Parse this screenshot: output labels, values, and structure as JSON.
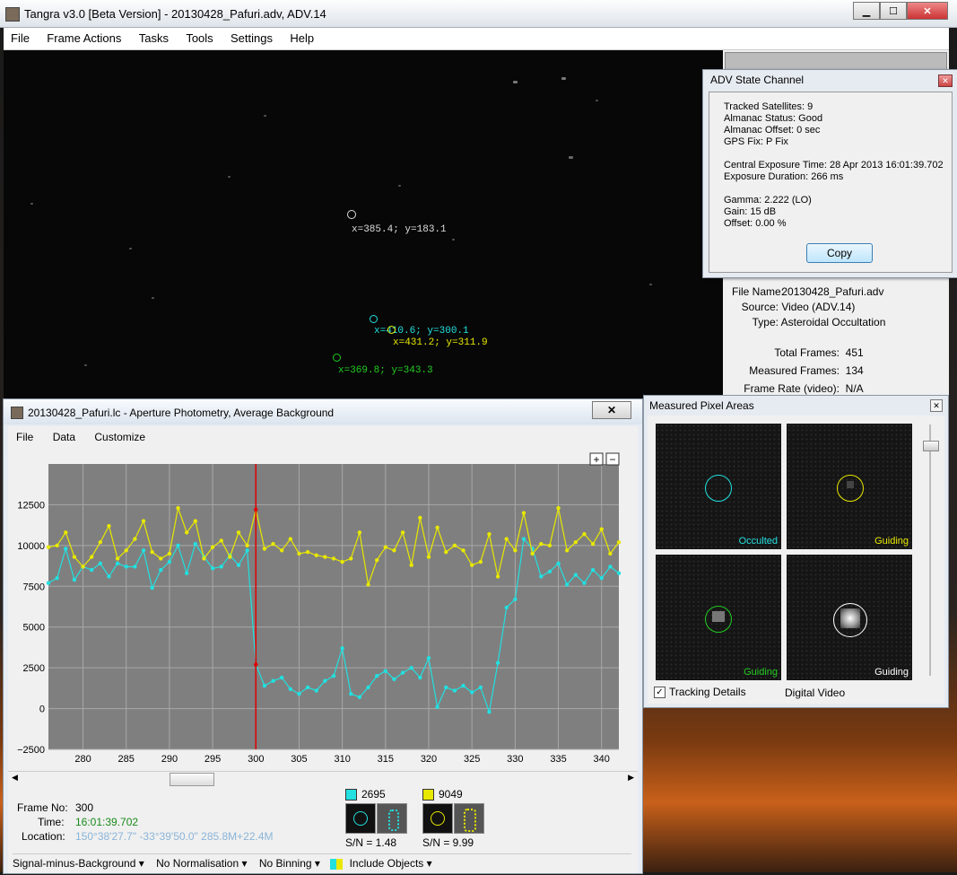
{
  "main": {
    "title": "Tangra v3.0 [Beta Version] - 20130428_Pafuri.adv, ADV.14",
    "menu": [
      "File",
      "Frame Actions",
      "Tasks",
      "Tools",
      "Settings",
      "Help"
    ],
    "apertures": [
      {
        "label": "x=385.4; y=183.1",
        "color": "#dddddd"
      },
      {
        "label": "x=410.6; y=300.1",
        "color": "#22e0e0"
      },
      {
        "label": "x=431.2; y=311.9",
        "color": "#e8e800"
      },
      {
        "label": "x=369.8; y=343.3",
        "color": "#22cc22"
      }
    ],
    "file_info": {
      "file_name_k": "File Name:",
      "file_name_v": "20130428_Pafuri.adv",
      "source_k": "Source:",
      "source_v": "Video (ADV.14)",
      "type_k": "Type:",
      "type_v": "Asteroidal Occultation",
      "total_frames_k": "Total Frames:",
      "total_frames_v": "451",
      "measured_frames_k": "Measured Frames:",
      "measured_frames_v": "134",
      "frame_rate_k": "Frame Rate (video):",
      "frame_rate_v": "N/A"
    }
  },
  "adv": {
    "title": "ADV State Channel",
    "lines": [
      "Tracked Satellites: 9",
      "Almanac Status: Good",
      "Almanac Offset: 0 sec",
      "GPS Fix: P Fix",
      "Central Exposure Time: 28 Apr 2013 16:01:39.702",
      "Exposure Duration: 266 ms",
      "Gamma: 2.222 (LO)",
      "Gain: 15 dB",
      "Offset: 0.00 %"
    ],
    "copy_label": "Copy"
  },
  "lc": {
    "title": "20130428_Pafuri.lc - Aperture Photometry, Average Background",
    "menu": [
      "File",
      "Data",
      "Customize"
    ],
    "zoom_in": "+",
    "zoom_out": "−",
    "frame_no_k": "Frame No:",
    "frame_no_v": "300",
    "time_k": "Time:",
    "time_v": "16:01:39.702",
    "location_k": "Location:",
    "location_v": "150°38'27.7\"  -33°39'50.0\"  285.8M+22.4M",
    "obj1_id": "2695",
    "obj1_sn": "S/N = 1.48",
    "obj2_id": "9049",
    "obj2_sn": "S/N = 9.99",
    "status": [
      "Signal-minus-Background ▾",
      "No Normalisation ▾",
      "No Binning ▾",
      "Include Objects ▾"
    ]
  },
  "mpa": {
    "title": "Measured Pixel Areas",
    "tiles": [
      {
        "label": "Occulted",
        "color": "#22e0e0"
      },
      {
        "label": "Guiding",
        "color": "#e8e800"
      },
      {
        "label": "Guiding",
        "color": "#22cc22"
      },
      {
        "label": "Guiding",
        "color": "#ffffff"
      }
    ],
    "tracking_details": "Tracking Details",
    "digital_video": "Digital Video"
  },
  "chart_data": {
    "type": "line",
    "xlim": [
      276,
      342
    ],
    "ylim": [
      -2500,
      15000
    ],
    "yticks": [
      -2500,
      0,
      2500,
      5000,
      7500,
      10000,
      12500
    ],
    "xticks": [
      280,
      285,
      290,
      295,
      300,
      305,
      310,
      315,
      320,
      325,
      330,
      335,
      340
    ],
    "cursor_x": 300,
    "x": [
      276,
      277,
      278,
      279,
      280,
      281,
      282,
      283,
      284,
      285,
      286,
      287,
      288,
      289,
      290,
      291,
      292,
      293,
      294,
      295,
      296,
      297,
      298,
      299,
      300,
      301,
      302,
      303,
      304,
      305,
      306,
      307,
      308,
      309,
      310,
      311,
      312,
      313,
      314,
      315,
      316,
      317,
      318,
      319,
      320,
      321,
      322,
      323,
      324,
      325,
      326,
      327,
      328,
      329,
      330,
      331,
      332,
      333,
      334,
      335,
      336,
      337,
      338,
      339,
      340,
      341,
      342
    ],
    "series": [
      {
        "name": "2695",
        "color": "#22e0e0",
        "values": [
          7700,
          8000,
          9800,
          7900,
          8700,
          8500,
          8900,
          8100,
          8900,
          8700,
          8700,
          9700,
          7400,
          8500,
          9000,
          10000,
          8300,
          10100,
          9300,
          8600,
          8700,
          9400,
          8800,
          9700,
          2700,
          1400,
          1700,
          1900,
          1200,
          900,
          1300,
          1100,
          1700,
          2000,
          3700,
          900,
          700,
          1300,
          2000,
          2300,
          1800,
          2200,
          2500,
          1900,
          3100,
          100,
          1300,
          1100,
          1400,
          1000,
          1300,
          -200,
          2800,
          6200,
          6700,
          10400,
          9800,
          8100,
          8400,
          8900,
          7600,
          8200,
          7700,
          8500,
          8000,
          8700,
          8300
        ]
      },
      {
        "name": "9049",
        "color": "#e8e800",
        "values": [
          9900,
          10000,
          10800,
          9300,
          8700,
          9300,
          10200,
          11200,
          9200,
          9700,
          10400,
          11500,
          9600,
          9200,
          9500,
          12300,
          10800,
          11500,
          9200,
          9900,
          10300,
          9300,
          10800,
          10000,
          12200,
          9800,
          10100,
          9700,
          10400,
          9500,
          9600,
          9400,
          9300,
          9200,
          9000,
          9200,
          10800,
          7600,
          9100,
          9900,
          9700,
          10800,
          8800,
          11700,
          9300,
          11100,
          9600,
          10000,
          9700,
          8800,
          9000,
          10700,
          8100,
          10400,
          9700,
          12000,
          9500,
          10100,
          10000,
          12300,
          9700,
          10200,
          10700,
          10100,
          11000,
          9500,
          10200
        ]
      }
    ]
  }
}
